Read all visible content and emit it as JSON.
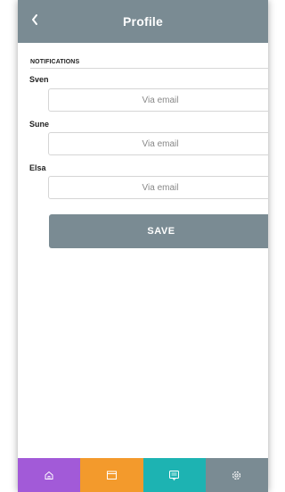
{
  "header": {
    "title": "Profile",
    "back_icon": "chevron-left-icon"
  },
  "notifications": {
    "heading": "NOTIFICATIONS",
    "people": [
      {
        "name": "Sven",
        "channel": "Via email"
      },
      {
        "name": "Sune",
        "channel": "Via email"
      },
      {
        "name": "Elsa",
        "channel": "Via email"
      }
    ]
  },
  "save_label": "SAVE",
  "tabbar": {
    "tabs": [
      {
        "icon": "home-icon",
        "color": "#a25ad8"
      },
      {
        "icon": "calendar-icon",
        "color": "#f39a2c"
      },
      {
        "icon": "message-icon",
        "color": "#1db3b2"
      },
      {
        "icon": "settings-gear-icon",
        "color": "#7a8b93"
      }
    ]
  },
  "colors": {
    "header": "#7a8b93",
    "save_button": "#7a8b93"
  }
}
